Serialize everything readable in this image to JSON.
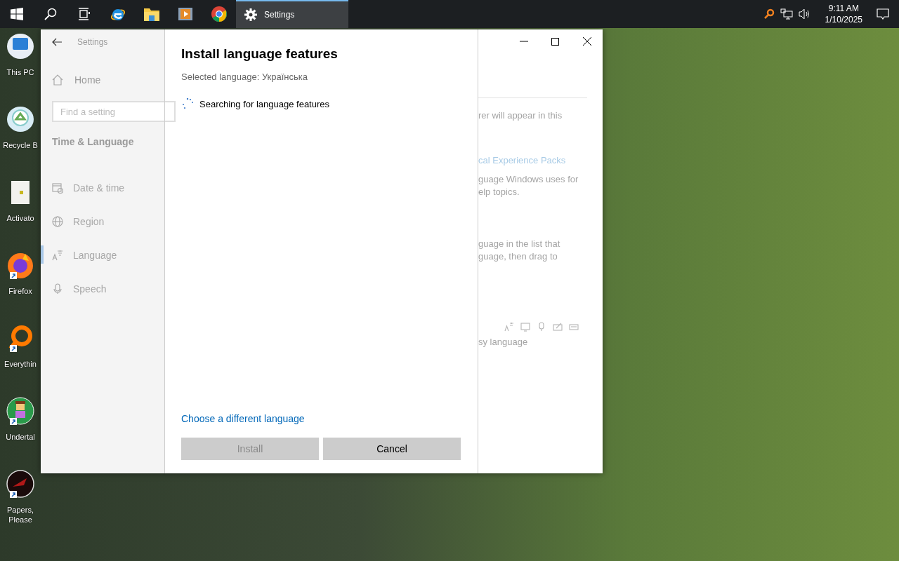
{
  "taskbar": {
    "apps": [
      {
        "kind": "start"
      },
      {
        "kind": "search"
      },
      {
        "kind": "task-view"
      },
      {
        "kind": "browser-e"
      },
      {
        "kind": "folder"
      },
      {
        "kind": "media"
      },
      {
        "kind": "chrome"
      },
      {
        "kind": "settings",
        "label": "Settings",
        "active": true
      }
    ],
    "clock": {
      "time": "9:11 AM",
      "date": "1/10/2025"
    }
  },
  "desktop_icons": [
    {
      "kind": "monitor",
      "label": "This PC",
      "shortcut": false
    },
    {
      "kind": "recycle",
      "label": "Recycle B",
      "shortcut": false
    },
    {
      "kind": "document",
      "label": "Activato",
      "shortcut": false
    },
    {
      "kind": "firefox",
      "label": "Firefox",
      "shortcut": true
    },
    {
      "kind": "magnifier",
      "label": "Everythin",
      "shortcut": true
    },
    {
      "kind": "character",
      "label": "Undertal",
      "shortcut": true
    },
    {
      "kind": "game",
      "label": "Papers, Please",
      "shortcut": true
    }
  ],
  "settings_window": {
    "title": "Settings",
    "sidebar": {
      "home": "Home",
      "search": {
        "placeholder": "Find a setting"
      },
      "section": "Time & Language",
      "items": [
        {
          "label": "Date & time",
          "selected": false
        },
        {
          "label": "Region",
          "selected": false
        },
        {
          "label": "Language",
          "selected": true
        },
        {
          "label": "Speech",
          "selected": false
        }
      ]
    },
    "background_lines": [
      {
        "kind": "text",
        "text": "rer will appear in this"
      },
      {
        "kind": "link",
        "text": "cal Experience Packs"
      },
      {
        "kind": "text",
        "text": "guage Windows uses for"
      },
      {
        "kind": "text",
        "text": "elp topics."
      },
      {
        "kind": "text",
        "text": "guage in the list that"
      },
      {
        "kind": "text",
        "text": "guage, then drag to"
      },
      {
        "kind": "text",
        "text": "sy language"
      }
    ],
    "dialog": {
      "title": "Install language features",
      "selected_language": "Selected language: Українська",
      "status": "Searching for language features",
      "link": "Choose a different language",
      "buttons": [
        {
          "label": "Install",
          "disabled": true
        },
        {
          "label": "Cancel",
          "disabled": false
        }
      ]
    }
  }
}
